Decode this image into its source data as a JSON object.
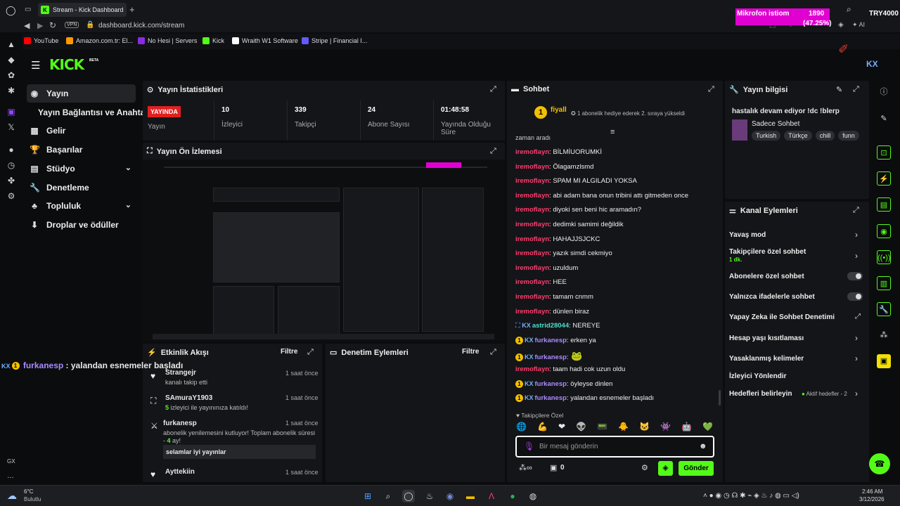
{
  "browser": {
    "tab_title": "Stream - Kick Dashboard",
    "url": "dashboard.kick.com/stream",
    "vpn": "VPN",
    "bookmarks": [
      "YouTube",
      "Amazon.com.tr: El...",
      "No Hesi | Servers",
      "Kick",
      "Wraith W1 Software",
      "Stripe | Financial I..."
    ]
  },
  "overlay": {
    "goal_label": "Mikrofon istiom",
    "goal_value": "1890",
    "goal_percent": "(47.25%)",
    "code": "TRY4000",
    "chat_overlay_user": "furkanesp",
    "chat_overlay_text": " : yalandan esnemeler başladı"
  },
  "gx": {
    "label": "GX"
  },
  "kick": {
    "logo": "KICK",
    "beta": "BETA"
  },
  "nav": [
    {
      "label": "Yayın"
    },
    {
      "label": "Yayın Bağlantısı ve Anahtarı"
    },
    {
      "label": "Gelir"
    },
    {
      "label": "Başarılar"
    },
    {
      "label": "Stüdyo"
    },
    {
      "label": "Denetleme"
    },
    {
      "label": "Topluluk"
    },
    {
      "label": "Droplar ve ödüller"
    }
  ],
  "stats": {
    "title": "Yayın İstatistikleri",
    "live_badge": "YAYINDA",
    "status_label": "Yayın",
    "viewers": "10",
    "viewers_label": "İzleyici",
    "followers": "339",
    "followers_label": "Takipçi",
    "subs": "24",
    "subs_label": "Abone Sayısı",
    "uptime": "01:48:58",
    "uptime_label": "Yayında Olduğu Süre"
  },
  "preview": {
    "title": "Yayın Ön İzlemesi"
  },
  "chat": {
    "title": "Sohbet",
    "pinned_user": "fiyall",
    "pinned_text": "1 abonelik hediye ederek 2. sıraya yükseldi",
    "partial": "zaman aradı",
    "messages": [
      {
        "user": "iremoflayn",
        "text": ": BİLMİUORUMKİ"
      },
      {
        "user": "iremoflayn",
        "text": ": Ölagamzlsmd"
      },
      {
        "user": "iremoflayn",
        "text": ": SPAM MI ALGILADI YOKSA"
      },
      {
        "user": "iremoflayn",
        "text": ": abi adam bana onun tribini attı gitmeden once"
      },
      {
        "user": "iremoflayn",
        "text": ": diyoki sen beni hic aramadın?"
      },
      {
        "user": "iremoflayn",
        "text": ": dedimki samimi değildik"
      },
      {
        "user": "iremoflayn",
        "text": ": HAHAJJSJCKC"
      },
      {
        "user": "iremoflayn",
        "text": ": yazık simdi cekmiyo"
      },
      {
        "user": "iremoflayn",
        "text": ": uzuldum"
      },
      {
        "user": "iremoflayn",
        "text": ": HEE"
      },
      {
        "user": "iremoflayn",
        "text": ": tamam cnmm"
      },
      {
        "user": "iremoflayn",
        "text": ": dünlen biraz"
      },
      {
        "user": "astrid28044",
        "text": ": NEREYE"
      },
      {
        "user": "furkanesp",
        "text": ": erken ya"
      },
      {
        "user": "furkanesp",
        "text": ":"
      },
      {
        "user": "iremoflayn",
        "text": ": taam hadi cok uzun oldu"
      },
      {
        "user": "furkanesp",
        "text": ": öyleyse dinlen"
      },
      {
        "user": "furkanesp",
        "text": ": yalandan esnemeler başladı"
      }
    ],
    "followers_only": "Takipçilere Özel",
    "input_placeholder": "Bir mesaj gönderin",
    "points": "0",
    "send": "Gönder",
    "infinity": "∞"
  },
  "info": {
    "title": "Yayın bilgisi",
    "stream_title": "hastalık devam ediyor !dc !blerp",
    "category": "Sadece Sohbet",
    "tags": [
      "Turkish",
      "Türkçe",
      "chill",
      "funn"
    ]
  },
  "actions": {
    "title": "Kanal Eylemleri",
    "items": [
      {
        "label": "Yavaş mod"
      },
      {
        "label": "Takipçilere özel sohbet",
        "sub": "1 dk."
      },
      {
        "label": "Abonelere özel sohbet"
      },
      {
        "label": "Yalnızca ifadelerle sohbet"
      },
      {
        "label": "Yapay Zeka ile Sohbet Denetimi"
      },
      {
        "label": "Hesap yaşı kısıtlaması"
      },
      {
        "label": "Yasaklanmış kelimeler"
      },
      {
        "label": "İzleyici Yönlendir"
      },
      {
        "label": "Hedefleri belirleyin",
        "sub": "Aktif hedefler - 2"
      }
    ]
  },
  "activity": {
    "title": "Etkinlik Akışı",
    "filter": "Filtre",
    "items": [
      {
        "user": "Strangejr",
        "text": "kanalı takip etti",
        "time": "1 saat önce"
      },
      {
        "user": "SAmuraY1903",
        "count": "5",
        "text": " izleyici ile yayınınıza katıldı!",
        "time": "1 saat önce"
      },
      {
        "user": "furkanesp",
        "text": "abonelik yenilemesini kutluyor! Toplam abonelik süresi - ",
        "months": "4",
        "months_suffix": " ay!",
        "quote": "selamlar iyi yayınlar",
        "time": "1 saat önce"
      },
      {
        "user": "Ayttekiin",
        "time": "1 saat önce"
      }
    ]
  },
  "moderation": {
    "title": "Denetim Eylemleri",
    "filter": "Filtre"
  },
  "taskbar": {
    "weather_temp": "6°C",
    "weather_desc": "Bulutlu",
    "time": "2:46 AM",
    "date": "3/12/2026"
  }
}
